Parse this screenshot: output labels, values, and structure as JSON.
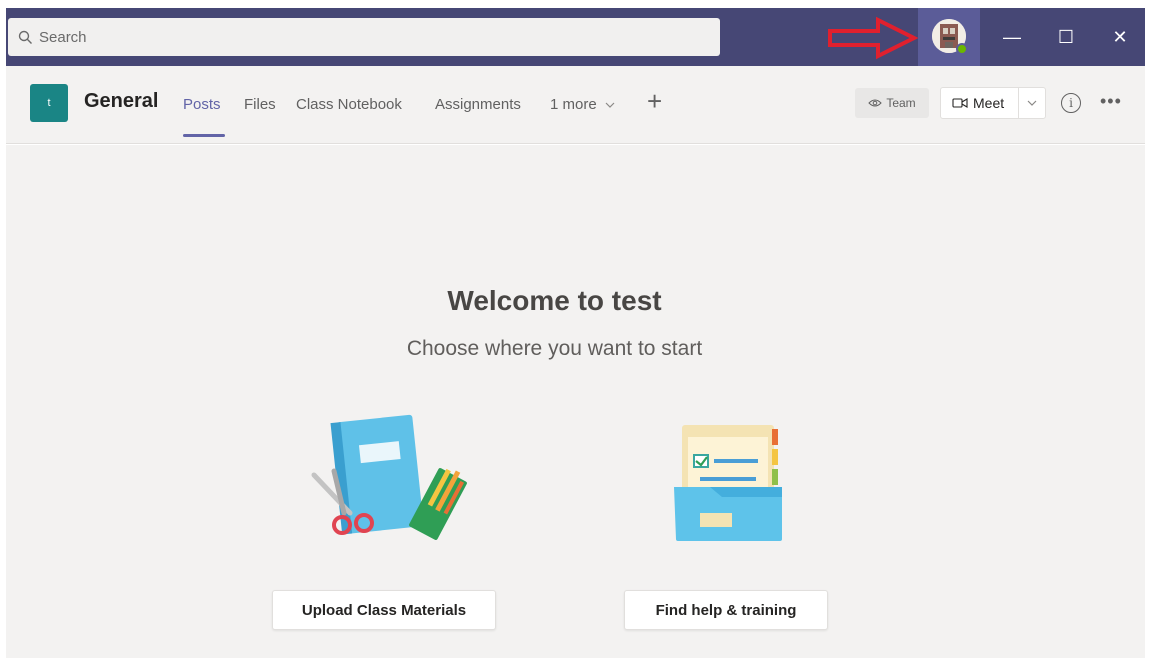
{
  "search": {
    "placeholder": "Search"
  },
  "window": {
    "minimize": "—",
    "maximize": "☐",
    "close": "✕"
  },
  "header": {
    "team_tile_letter": "t",
    "channel_name": "General",
    "tabs": [
      {
        "label": "Posts",
        "active": true
      },
      {
        "label": "Files",
        "active": false
      },
      {
        "label": "Class Notebook",
        "active": false
      },
      {
        "label": "Assignments",
        "active": false
      },
      {
        "label": "1 more",
        "active": false
      }
    ],
    "add_tab": "+",
    "team_button": "Team",
    "meet_button": "Meet",
    "info_icon": "i",
    "more_icon": "•••"
  },
  "welcome": {
    "title": "Welcome to test",
    "subtitle": "Choose where you want to start",
    "actions": [
      {
        "label": "Upload Class Materials"
      },
      {
        "label": "Find help & training"
      }
    ]
  },
  "colors": {
    "titlebar": "#464775",
    "accent": "#6264a7",
    "team_tile": "#1a8585",
    "annotation_arrow": "#e0202e",
    "presence": "#6bb700"
  }
}
